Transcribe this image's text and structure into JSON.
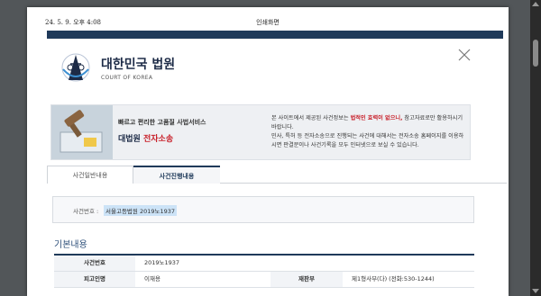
{
  "print_header": {
    "date": "24. 5. 9. 오후 4:08",
    "title": "인쇄화면"
  },
  "logo": {
    "title": "대한민국 법원",
    "subtitle": "COURT OF KOREA"
  },
  "banner": {
    "tagline": "빠르고 편리한 고품질 사법서비스",
    "service_prefix": "대법원",
    "service_name": "전자소송",
    "notice_part1": "본 사이트에서 제공된 사건정보는 ",
    "notice_warn": "법적인 효력이 없으니,",
    "notice_part2": " 참고자료로만 활용하시기 바랍니다.",
    "notice_line2": "민사, 특허 등 전자소송으로 진행되는 사건에 대해서는 전자소송 홈페이지를 이용하시면 판결문이나 사건기록을 모두 인터넷으로 보실 수 있습니다."
  },
  "tabs": [
    {
      "label": "사건일반내용"
    },
    {
      "label": "사건진행내용"
    }
  ],
  "case": {
    "label": "사건번호 :",
    "value": "서울고등법원 2019노1937"
  },
  "section": {
    "title": "기본내용"
  },
  "table": {
    "rows": [
      {
        "h1": "사건번호",
        "v1": "2019노1937",
        "h2": "",
        "v2": ""
      },
      {
        "h1": "피고인명",
        "v1": "이재용",
        "h2": "재판부",
        "v2": "제1형사부(다) (전화:530-1244)"
      }
    ]
  },
  "colors": {
    "navy": "#1f3a5a",
    "accent_red": "#c8202a",
    "highlight": "#cce3f7"
  }
}
